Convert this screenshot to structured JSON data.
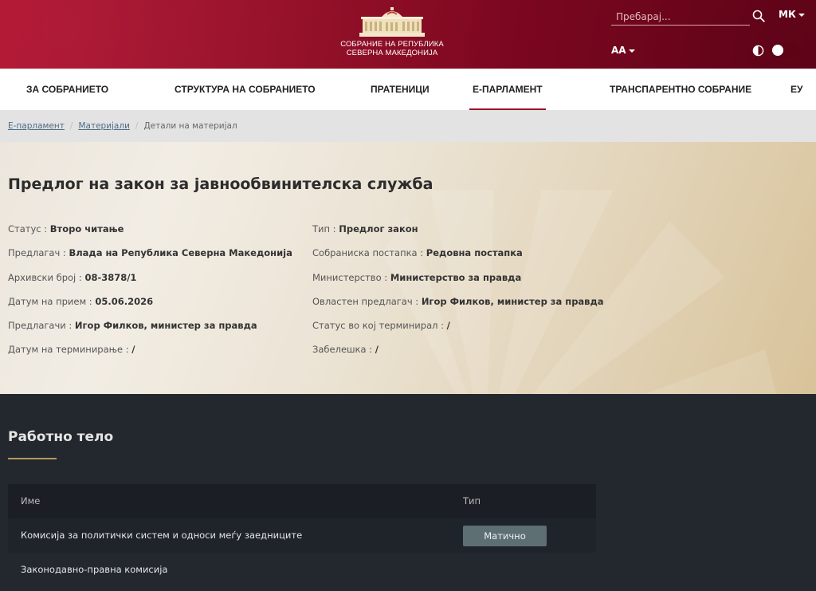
{
  "header": {
    "logo_line1": "СОБРАНИЕ НА РЕПУБЛИКА",
    "logo_line2": "СЕВЕРНА МАКЕДОНИЈА",
    "search_placeholder": "Пребарај...",
    "language": "МК",
    "font_size_label": "AA"
  },
  "nav": {
    "items": [
      {
        "label": "ЗА СОБРАНИЕТО"
      },
      {
        "label": "СТРУКТУРА НА СОБРАНИЕТО"
      },
      {
        "label": "ПРАТЕНИЦИ"
      },
      {
        "label": "Е-ПАРЛАМЕНТ"
      },
      {
        "label": "ТРАНСПАРЕНТНО СОБРАНИЕ"
      },
      {
        "label": "ЕУ"
      }
    ],
    "active": "Е-ПАРЛАМЕНТ"
  },
  "breadcrumb": {
    "items": [
      "Е-парламент",
      "Материјали",
      "Детали на материјал"
    ]
  },
  "detail": {
    "title": "Предлог на закон за јавнообвинителска служба",
    "left_fields": [
      {
        "label": "Статус",
        "value": "Второ читање"
      },
      {
        "label": "Предлагач",
        "value": "Влада на Република Северна Македонија"
      },
      {
        "label": "Архивски број",
        "value": "08-3878/1"
      },
      {
        "label": "Датум на прием",
        "value": "05.06.2026"
      },
      {
        "label": "Предлагачи",
        "value": "Игор Филков, министер за правда"
      },
      {
        "label": "Датум на терминирање",
        "value": "/"
      }
    ],
    "right_fields": [
      {
        "label": "Тип",
        "value": "Предлог закон"
      },
      {
        "label": "Собраниска постапка",
        "value": "Редовна постапка"
      },
      {
        "label": "Министерство",
        "value": "Министерство за правда"
      },
      {
        "label": "Овластен предлагач",
        "value": "Игор Филков, министер за правда"
      },
      {
        "label": "Статус во кој терминирал",
        "value": "/"
      },
      {
        "label": "Забелешка",
        "value": "/"
      }
    ]
  },
  "work_body": {
    "title": "Работно тело",
    "columns": [
      "Име",
      "Тип"
    ],
    "rows": [
      {
        "name": "Комисија за политички систем и односи меѓу заедниците",
        "type": "Матично"
      },
      {
        "name": "Законодавно-правна комисија",
        "type": ""
      }
    ]
  },
  "colors": {
    "header_red": "#8f0a23",
    "nav_active_underline": "#a00b27",
    "section_underline_gold": "#b99a5b",
    "badge": "#5d6f73",
    "dark_bg": "#23272e"
  }
}
